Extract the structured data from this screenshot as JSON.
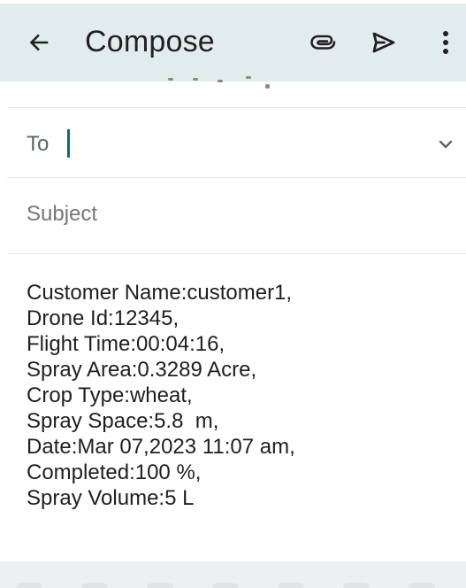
{
  "top_bar": {
    "title": "Compose",
    "icons": {
      "back": "back-arrow-icon",
      "attach": "paperclip-icon",
      "send": "send-icon",
      "more": "more-vertical-icon"
    },
    "colors": {
      "background": "#e3ecec",
      "icon": "#202124"
    }
  },
  "recipient": {
    "label": "To",
    "value": "",
    "icons": {
      "expand": "chevron-down-icon"
    },
    "caret_color": "#0b6e72"
  },
  "subject": {
    "placeholder": "Subject",
    "value": ""
  },
  "body": {
    "lines": [
      "Customer Name:customer1,",
      "Drone Id:12345,",
      "Flight Time:00:04:16,",
      "Spray Area:0.3289 Acre,",
      "Crop Type:wheat,",
      "Spray Space:5.8  m,",
      "Date:Mar 07,2023 11:07 am,",
      "Completed:100 %,",
      "Spray Volume:5 L"
    ]
  },
  "colors": {
    "divider": "#e5e7e8",
    "text_primary": "#1f1f1f",
    "text_secondary": "#5f6368",
    "bottom_strip": "#edf0f0"
  }
}
